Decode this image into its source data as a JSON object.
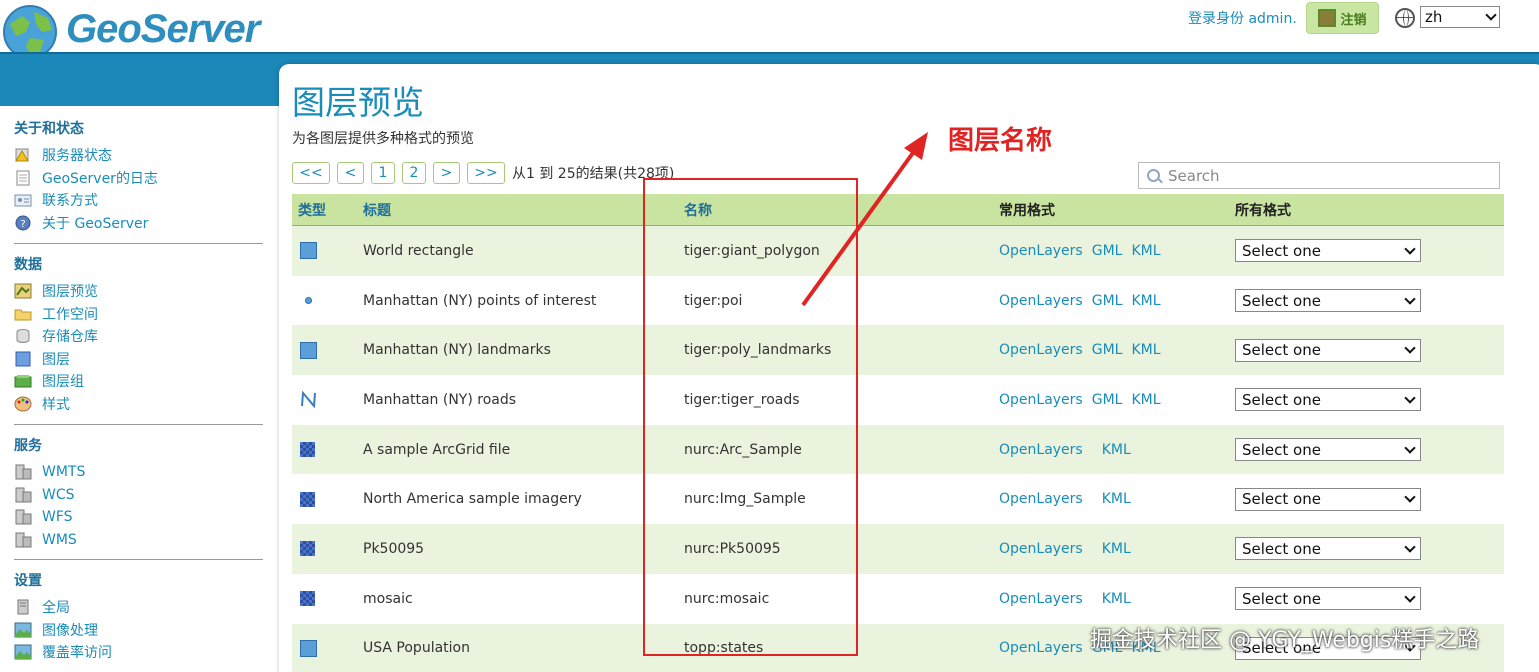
{
  "header": {
    "brand": "GeoServer",
    "login_text": "登录身份 admin.",
    "logout_label": "注销",
    "language": "zh"
  },
  "sidebar": {
    "sections": [
      {
        "title": "关于和状态",
        "items": [
          {
            "label": "服务器状态",
            "icon": "server-status-icon"
          },
          {
            "label": "GeoServer的日志",
            "icon": "log-icon"
          },
          {
            "label": "联系方式",
            "icon": "contact-icon"
          },
          {
            "label": "关于 GeoServer",
            "icon": "about-icon"
          }
        ]
      },
      {
        "title": "数据",
        "items": [
          {
            "label": "图层预览",
            "icon": "layer-preview-icon"
          },
          {
            "label": "工作空间",
            "icon": "workspace-icon"
          },
          {
            "label": "存储仓库",
            "icon": "store-icon"
          },
          {
            "label": "图层",
            "icon": "layer-icon"
          },
          {
            "label": "图层组",
            "icon": "layer-group-icon"
          },
          {
            "label": "样式",
            "icon": "style-icon"
          }
        ]
      },
      {
        "title": "服务",
        "items": [
          {
            "label": "WMTS",
            "icon": "service-icon"
          },
          {
            "label": "WCS",
            "icon": "service-icon"
          },
          {
            "label": "WFS",
            "icon": "service-icon"
          },
          {
            "label": "WMS",
            "icon": "service-icon"
          }
        ]
      },
      {
        "title": "设置",
        "items": [
          {
            "label": "全局",
            "icon": "global-settings-icon"
          },
          {
            "label": "图像处理",
            "icon": "image-processing-icon"
          },
          {
            "label": "覆盖率访问",
            "icon": "coverage-access-icon"
          }
        ]
      }
    ]
  },
  "main": {
    "title": "图层预览",
    "description": "为各图层提供多种格式的预览",
    "pager": {
      "first": "<<",
      "prev": "<",
      "page1": "1",
      "page2": "2",
      "next": ">",
      "last": ">>",
      "info": "从1 到 25的结果(共28项)"
    },
    "search_placeholder": "Search",
    "columns": {
      "type": "类型",
      "title": "标题",
      "name": "名称",
      "common_formats": "常用格式",
      "all_formats": "所有格式"
    },
    "rows": [
      {
        "type": "polygon",
        "title": "World rectangle",
        "name": "tiger:giant_polygon",
        "formats": [
          "OpenLayers",
          "GML",
          "KML"
        ],
        "select": "Select one"
      },
      {
        "type": "point",
        "title": "Manhattan (NY) points of interest",
        "name": "tiger:poi",
        "formats": [
          "OpenLayers",
          "GML",
          "KML"
        ],
        "select": "Select one"
      },
      {
        "type": "polygon",
        "title": "Manhattan (NY) landmarks",
        "name": "tiger:poly_landmarks",
        "formats": [
          "OpenLayers",
          "GML",
          "KML"
        ],
        "select": "Select one"
      },
      {
        "type": "line",
        "title": "Manhattan (NY) roads",
        "name": "tiger:tiger_roads",
        "formats": [
          "OpenLayers",
          "GML",
          "KML"
        ],
        "select": "Select one"
      },
      {
        "type": "raster",
        "title": "A sample ArcGrid file",
        "name": "nurc:Arc_Sample",
        "formats": [
          "OpenLayers",
          "",
          "KML"
        ],
        "select": "Select one"
      },
      {
        "type": "raster",
        "title": "North America sample imagery",
        "name": "nurc:Img_Sample",
        "formats": [
          "OpenLayers",
          "",
          "KML"
        ],
        "select": "Select one"
      },
      {
        "type": "raster",
        "title": "Pk50095",
        "name": "nurc:Pk50095",
        "formats": [
          "OpenLayers",
          "",
          "KML"
        ],
        "select": "Select one"
      },
      {
        "type": "raster",
        "title": "mosaic",
        "name": "nurc:mosaic",
        "formats": [
          "OpenLayers",
          "",
          "KML"
        ],
        "select": "Select one"
      },
      {
        "type": "polygon",
        "title": "USA Population",
        "name": "topp:states",
        "formats": [
          "OpenLayers",
          "GML",
          "KML"
        ],
        "select": "Select one"
      }
    ]
  },
  "annotation": {
    "label": "图层名称",
    "color": "#e02424"
  },
  "watermark": "掘金技术社区 @ YGY_Webgis糕手之路",
  "colors": {
    "accent": "#1a8cb8",
    "band": "#1c87b9",
    "header_row": "#c9e3a0",
    "alt_row": "#eaf3dd"
  }
}
